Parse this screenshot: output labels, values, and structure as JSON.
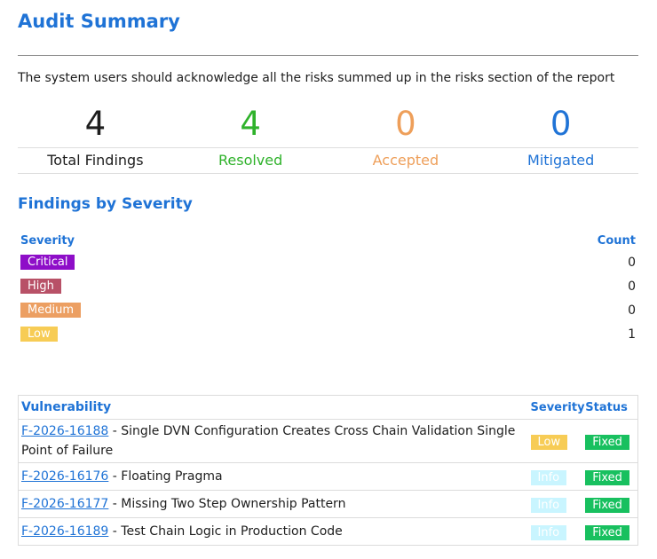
{
  "header": {
    "title": "Audit Summary",
    "intro": "The system users should acknowledge all the risks summed up in the risks section of the report"
  },
  "stats": [
    {
      "value": "4",
      "label": "Total Findings",
      "color": "#1d1d1d"
    },
    {
      "value": "4",
      "label": "Resolved",
      "color": "#2fb22b"
    },
    {
      "value": "0",
      "label": "Accepted",
      "color": "#ee9f5a"
    },
    {
      "value": "0",
      "label": "Mitigated",
      "color": "#1f73d6"
    }
  ],
  "severity_section": {
    "title": "Findings by Severity",
    "col_severity": "Severity",
    "col_count": "Count",
    "rows": [
      {
        "label": "Critical",
        "count": "0",
        "color": "#8e0ec8"
      },
      {
        "label": "High",
        "count": "0",
        "color": "#b85167"
      },
      {
        "label": "Medium",
        "count": "0",
        "color": "#ec9f62"
      },
      {
        "label": "Low",
        "count": "1",
        "color": "#f7cc55"
      }
    ]
  },
  "vuln_table": {
    "col_vulnerability": "Vulnerability",
    "col_severity": "Severity",
    "col_status": "Status",
    "rows": [
      {
        "id": "F-2026-16188",
        "title": " - Single DVN Configuration Creates Cross Chain Validation Single Point of Failure",
        "severity": "Low",
        "status": "Fixed"
      },
      {
        "id": "F-2026-16176",
        "title": " - Floating Pragma",
        "severity": "Info",
        "status": "Fixed"
      },
      {
        "id": "F-2026-16177",
        "title": " - Missing Two Step Ownership Pattern",
        "severity": "Info",
        "status": "Fixed"
      },
      {
        "id": "F-2026-16189",
        "title": " - Test Chain Logic in Production Code",
        "severity": "Info",
        "status": "Fixed"
      }
    ]
  }
}
